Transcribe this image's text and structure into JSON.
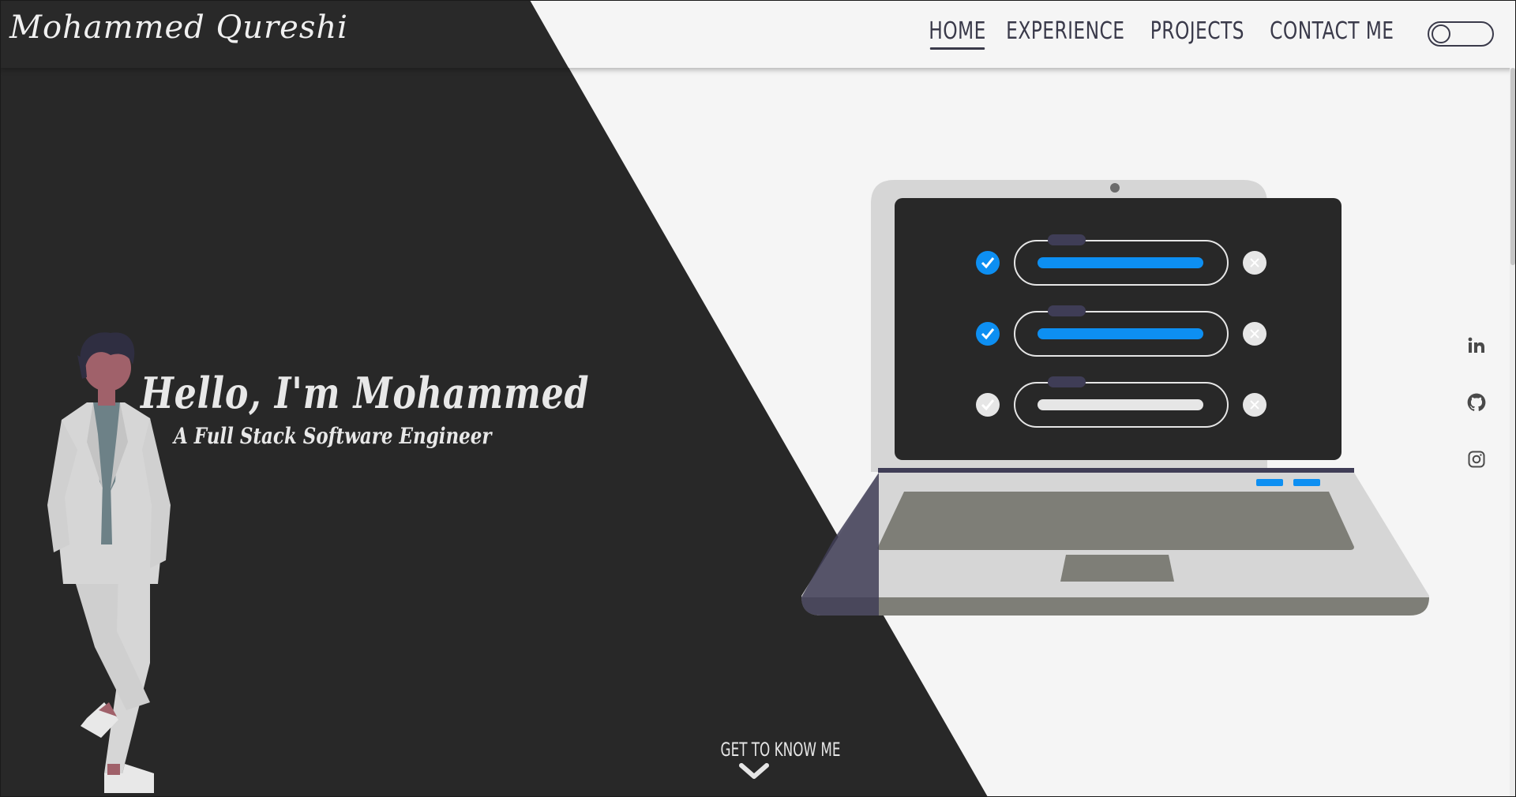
{
  "logo": "Mohammed Qureshi",
  "nav": {
    "items": [
      {
        "label": "HOME",
        "active": true
      },
      {
        "label": "EXPERIENCE",
        "active": false
      },
      {
        "label": "PROJECTS",
        "active": false
      },
      {
        "label": "CONTACT ME",
        "active": false
      }
    ],
    "theme_toggle": "off"
  },
  "hero": {
    "greeting": "Hello, I'm Mohammed",
    "subtitle": "A Full Stack Software Engineer"
  },
  "social": [
    {
      "icon": "linkedin-icon"
    },
    {
      "icon": "github-icon"
    },
    {
      "icon": "instagram-icon"
    }
  ],
  "cta": {
    "label": "GET TO KNOW ME",
    "icon": "chevron-down-icon"
  },
  "colors": {
    "dark": "#282828",
    "light": "#f5f5f5",
    "accent": "#0d8ff2",
    "navy": "#3f3d56",
    "suit": "#d6d6d6"
  }
}
